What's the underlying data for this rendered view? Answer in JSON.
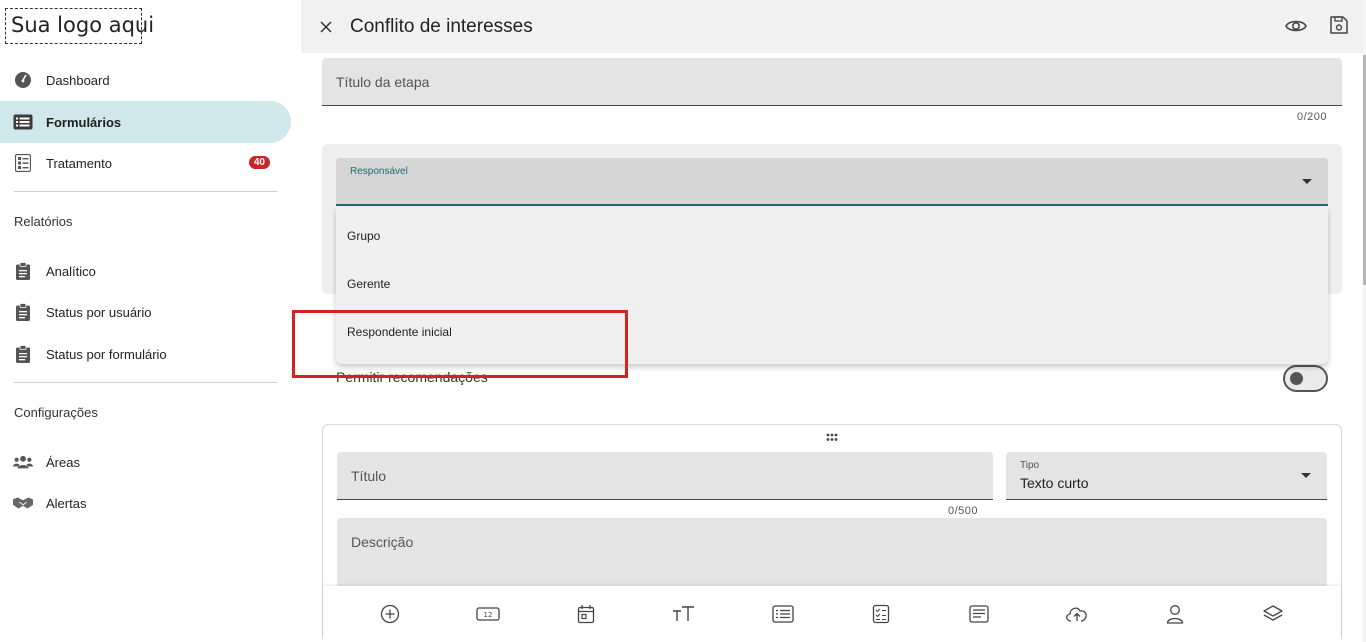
{
  "sidebar": {
    "logo": "Sua logo aqui",
    "items": [
      {
        "label": "Dashboard",
        "icon": "dashboard-icon"
      },
      {
        "label": "Formulários",
        "icon": "form-list-icon",
        "active": true
      },
      {
        "label": "Tratamento",
        "icon": "checklist-icon",
        "badge": "40"
      }
    ],
    "reports_title": "Relatórios",
    "reports": [
      {
        "label": "Analítico",
        "icon": "clipboard-icon"
      },
      {
        "label": "Status por usuário",
        "icon": "clipboard-icon"
      },
      {
        "label": "Status por formulário",
        "icon": "clipboard-icon"
      }
    ],
    "config_title": "Configurações",
    "config": [
      {
        "label": "Áreas",
        "icon": "group-icon"
      },
      {
        "label": "Alertas",
        "icon": "handshake-icon"
      }
    ]
  },
  "header": {
    "title": "Conflito de interesses"
  },
  "step": {
    "title_placeholder": "Título da etapa",
    "title_counter": "0/200"
  },
  "responsible": {
    "label": "Responsável",
    "options": [
      "Grupo",
      "Gerente",
      "Respondente inicial"
    ]
  },
  "permit": {
    "label": "Permitir recomendações",
    "enabled": false
  },
  "question": {
    "title_placeholder": "Título",
    "title_counter": "0/500",
    "type_label": "Tipo",
    "type_value": "Texto curto",
    "description_placeholder": "Descrição"
  },
  "toolbar": {
    "icons": [
      "add-circle-icon",
      "number-field-icon",
      "calendar-icon",
      "text-size-icon",
      "list-icon",
      "checklist-icon",
      "paragraph-icon",
      "upload-cloud-icon",
      "user-icon",
      "layers-icon"
    ]
  },
  "colors": {
    "accent": "#1d6a78",
    "active_nav": "#cfe8ec",
    "badge": "#c62828",
    "highlight": "#d92020"
  }
}
